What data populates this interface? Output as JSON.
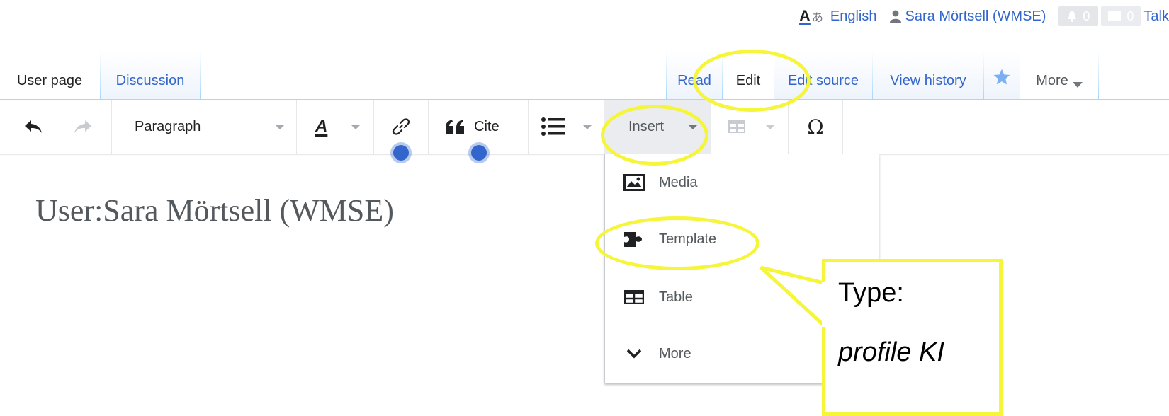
{
  "personal": {
    "uls_glyph_a": "A",
    "uls_glyph_kana": "あ",
    "language": "English",
    "username": "Sara Mörtsell (WMSE)",
    "alerts_count": "0",
    "notices_count": "0",
    "talk": "Talk"
  },
  "namespaces": {
    "user_page": "User page",
    "discussion": "Discussion"
  },
  "views": {
    "read": "Read",
    "edit": "Edit",
    "edit_source": "Edit source",
    "view_history": "View history",
    "more": "More"
  },
  "toolbar": {
    "paragraph": "Paragraph",
    "cite": "Cite",
    "insert": "Insert",
    "special_char": "Ω"
  },
  "page": {
    "title": "User:Sara Mörtsell (WMSE)"
  },
  "insert_menu": {
    "items": [
      {
        "label": "Media",
        "icon": "image-icon"
      },
      {
        "label": "Template",
        "icon": "puzzle-icon"
      },
      {
        "label": "Table",
        "icon": "table-icon"
      },
      {
        "label": "More",
        "icon": "chevron-down-icon"
      }
    ]
  },
  "annotation": {
    "line1": "Type:",
    "line2": "profile KI",
    "highlight_color": "#f5f53a"
  },
  "colors": {
    "link": "#3366cc",
    "text": "#202122",
    "tab_border": "#a7d7f9"
  }
}
